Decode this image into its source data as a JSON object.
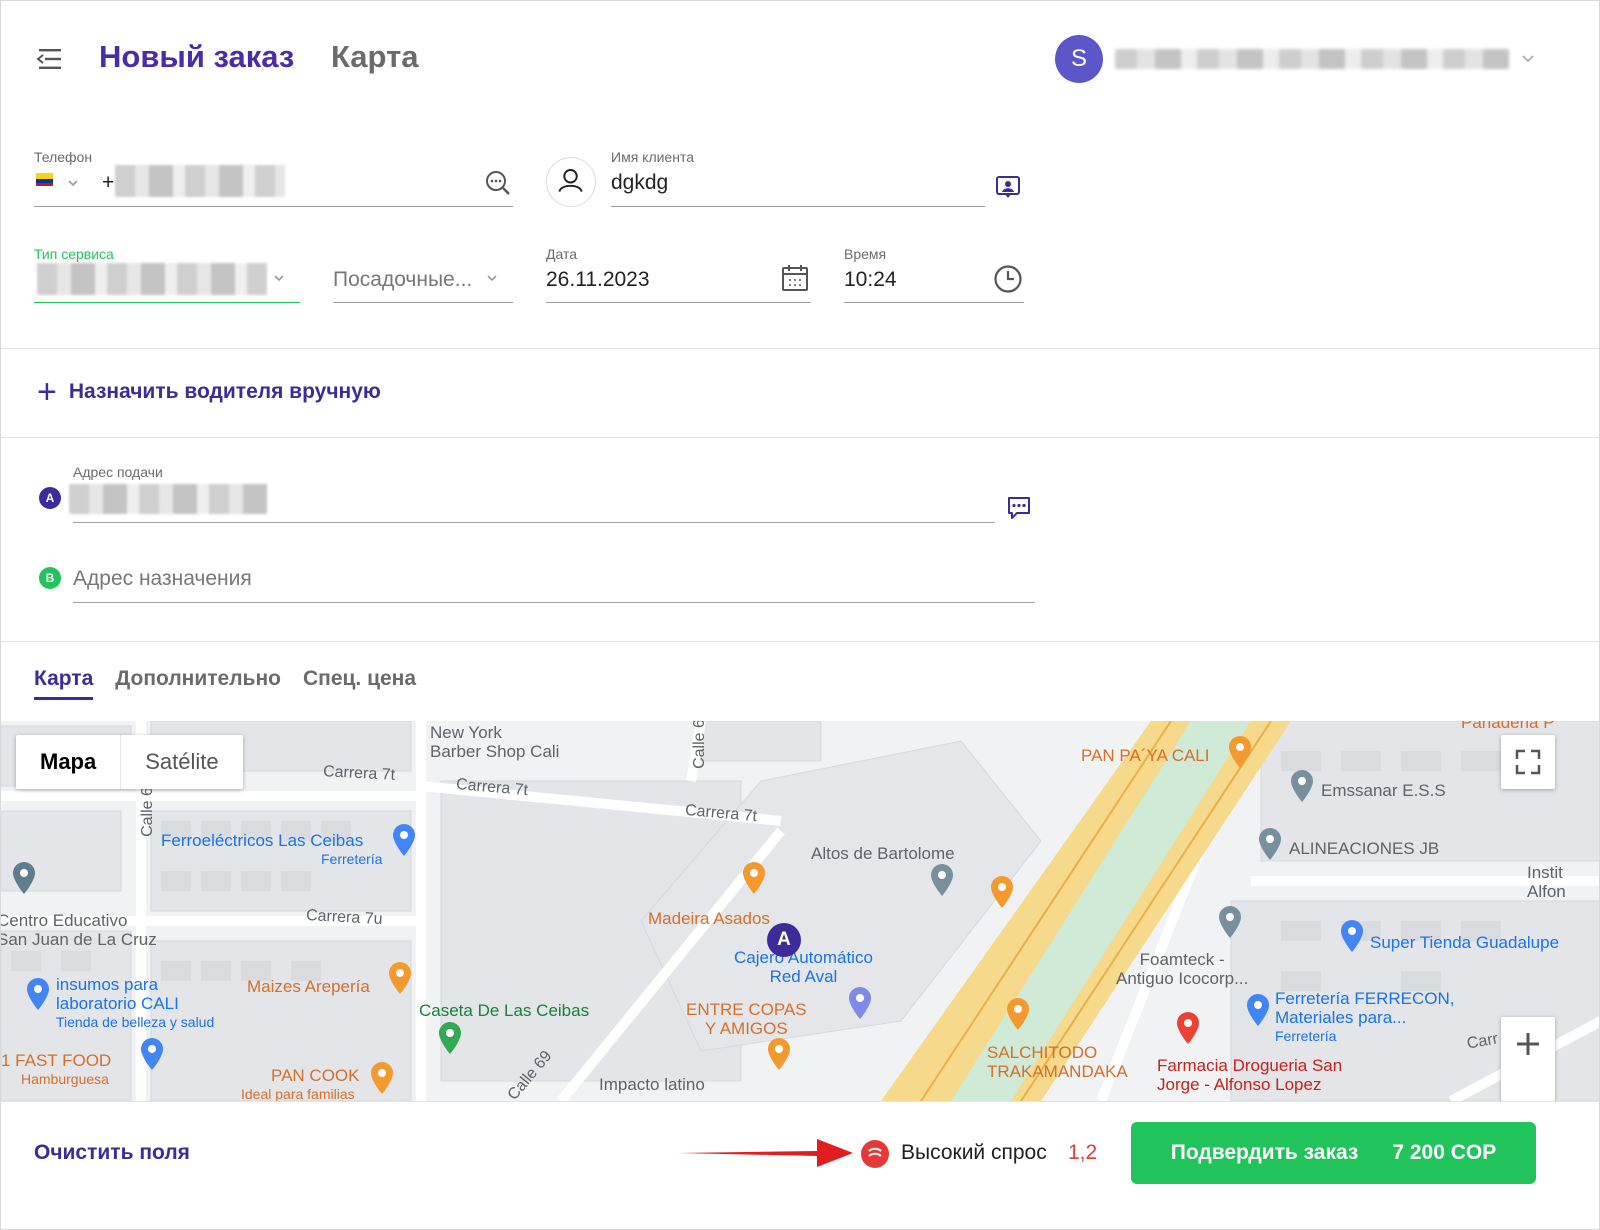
{
  "header": {
    "title": "Новый заказ",
    "subtitle": "Карта",
    "avatar_letter": "S"
  },
  "form": {
    "phone": {
      "label": "Телефон",
      "prefix": "+"
    },
    "client_name": {
      "label": "Имя клиента",
      "value": "dgkdg"
    },
    "service_type": {
      "label": "Тип сервиса"
    },
    "seats": {
      "placeholder": "Посадочные..."
    },
    "date": {
      "label": "Дата",
      "value": "26.11.2023"
    },
    "time": {
      "label": "Время",
      "value": "10:24"
    }
  },
  "assign_driver": {
    "label": "Назначить водителя вручную"
  },
  "addresses": {
    "pickup": {
      "label": "Адрес подачи",
      "marker": "A"
    },
    "destination": {
      "placeholder": "Адрес назначения",
      "marker": "B"
    }
  },
  "tabs": [
    {
      "label": "Карта",
      "active": true
    },
    {
      "label": "Дополнительно",
      "active": false
    },
    {
      "label": "Спец. цена",
      "active": false
    }
  ],
  "map": {
    "type_options": [
      "Mapa",
      "Satélite"
    ],
    "selected_type": "Mapa",
    "pickup_marker": "A",
    "streets": [
      "Carrera 7t",
      "Carrera 7t",
      "Carrera 7t",
      "Carrera 7u",
      "Calle 6",
      "Calle 6",
      "Calle 69",
      "Carr"
    ],
    "places": {
      "new_york": [
        "New York",
        "Barber Shop Cali"
      ],
      "ferro": "Ferroeléctricos Las Ceibas",
      "ferro_sub": "Ferretería",
      "centro": [
        "Centro Educativo",
        "San Juan de La Cruz"
      ],
      "insumos": [
        "insumos para",
        "laboratorio CALI"
      ],
      "insumos_sub": "Tienda de belleza y salud",
      "fast_food": "1 FAST FOOD",
      "fast_food_sub": "Hamburguesa",
      "maizes": "Maizes Arepería",
      "pan_cook": "PAN COOK",
      "pan_cook_sub": "Ideal para familias",
      "caseta": "Caseta De Las Ceibas",
      "impacto": "Impacto latino",
      "madeira": "Madeira Asados",
      "cajero": [
        "Cajero Automático",
        "Red Aval"
      ],
      "entre_copas": [
        "ENTRE COPAS",
        "Y AMIGOS"
      ],
      "altos": "Altos de Bartolome",
      "panpaya": "PAN PA´YA CALI",
      "salchitodo": [
        "SALCHITODO",
        "TRAKAMANDAKA"
      ],
      "emssanar": "Emssanar E.S.S",
      "alineaciones": "ALINEACIONES JB",
      "foamteck": [
        "Foamteck -",
        "Antiguo Icocorp..."
      ],
      "farmacia": [
        "Farmacia Drogueria San",
        "Jorge - Alfonso Lopez"
      ],
      "ferrecon": [
        "Ferretería FERRECON,",
        "Materiales para..."
      ],
      "ferrecon_sub": "Ferretería",
      "super_tienda": "Super Tienda Guadalupe",
      "instit": [
        "Instit",
        "Alfon"
      ],
      "panaderia": "Panaderia P"
    }
  },
  "footer": {
    "clear_label": "Очистить поля",
    "demand_label": "Высокий спрос",
    "demand_value": "1,2",
    "confirm_label": "Подвердить заказ",
    "price": "7 200 COP"
  },
  "colors": {
    "brand_purple": "#4a2ba8",
    "confirm_green": "#21c45a",
    "demand_red": "#e53935",
    "marker_b_green": "#21c45a"
  },
  "icons": [
    "menu-icon",
    "search-icon",
    "person-icon",
    "contact-card-icon",
    "calendar-icon",
    "clock-icon",
    "chat-icon",
    "plus-icon",
    "fullscreen-icon",
    "zoom-in-icon",
    "demand-icon",
    "chevron-down-icon"
  ]
}
